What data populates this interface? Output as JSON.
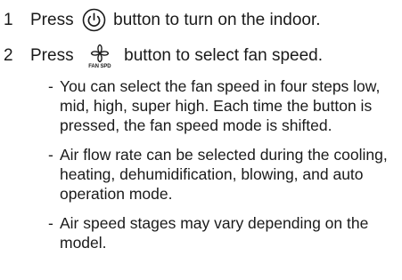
{
  "steps": [
    {
      "number": "1",
      "before_icon": "Press",
      "icon": "power-icon",
      "after_icon": "button to turn on the indoor."
    },
    {
      "number": "2",
      "before_icon": "Press",
      "icon": "fan-icon",
      "icon_caption": "FAN SPD",
      "after_icon": "button to select fan speed."
    }
  ],
  "notes": [
    {
      "dash": "-",
      "text": "You can select the fan speed in four steps low, mid, high, super high. Each time the button is pressed, the fan speed mode is shifted."
    },
    {
      "dash": "-",
      "text": "Air flow rate can be selected during the cooling, heating, dehumidification, blowing, and auto operation mode."
    },
    {
      "dash": "-",
      "text": "Air speed stages may vary depending on the model."
    }
  ],
  "colors": {
    "text": "#1a1a1a",
    "background": "#ffffff"
  }
}
